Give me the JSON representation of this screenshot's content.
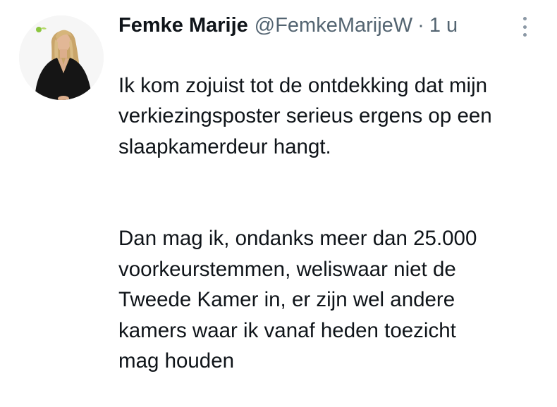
{
  "author": {
    "display_name": "Femke Marije",
    "handle": "@FemkeMarijeW",
    "separator": "·",
    "timestamp": "1 u",
    "avatar_icon": "profile-photo"
  },
  "tweet": {
    "paragraph_1": "Ik kom zojuist tot de ontdekking dat mijn\nverkiezingsposter serieus ergens op een\nslaapkamerdeur hangt.",
    "paragraph_2": "Dan mag ik, ondanks meer dan 25.000\nvoorkeurstemmen, weliswaar niet de\nTweede Kamer in, er zijn wel andere\nkamers waar ik vanaf heden toezicht\nmag houden"
  },
  "actions": {
    "more_icon": "more-vertical-icon"
  },
  "colors": {
    "text_primary": "#0f1419",
    "text_secondary": "#536471",
    "background": "#ffffff"
  }
}
